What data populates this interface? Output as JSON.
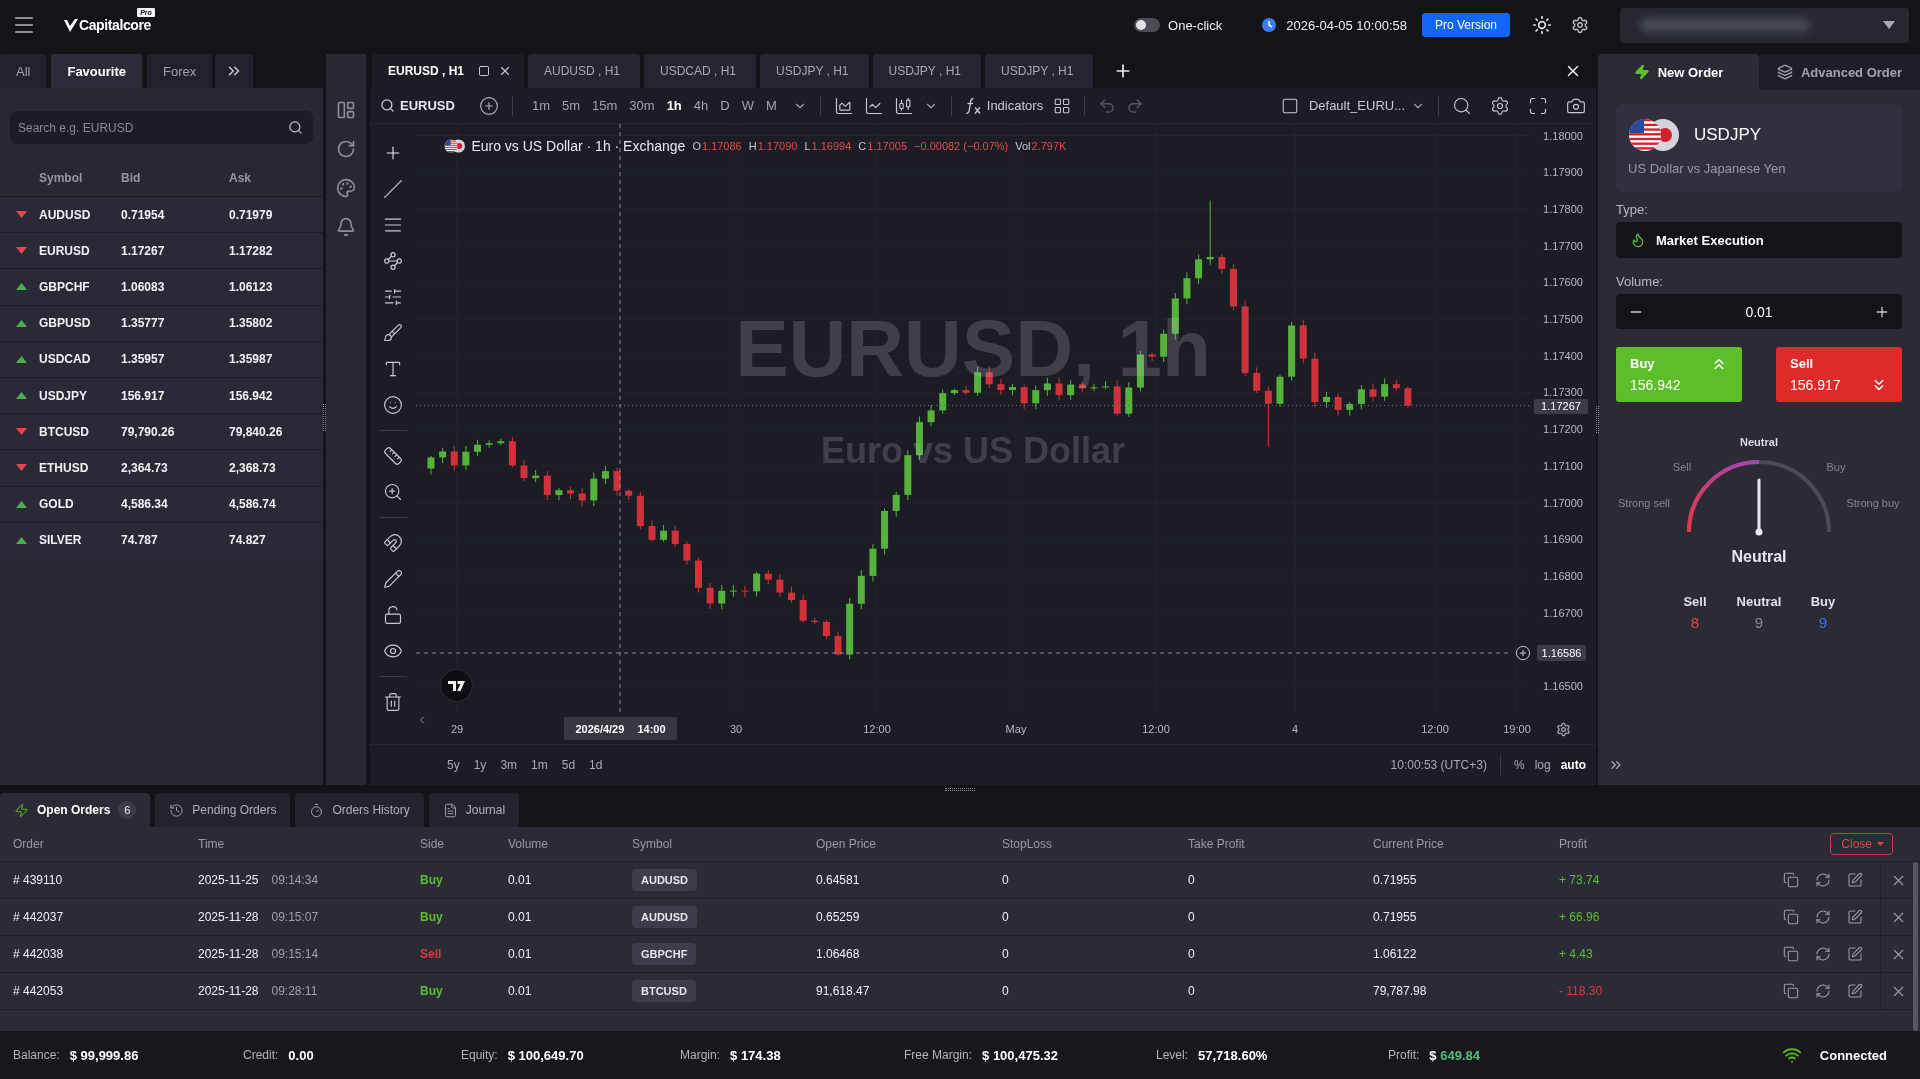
{
  "top_bar": {
    "logo": {
      "name": "Capitalcore",
      "badge": "Pro"
    },
    "one_click": {
      "label": "One-click",
      "on": false
    },
    "datetime": "2026-04-05 10:00:58",
    "pro_button": "Pro Version"
  },
  "watchlist": {
    "tabs": [
      {
        "label": "All",
        "selected": false
      },
      {
        "label": "Favourite",
        "selected": true
      },
      {
        "label": "Forex",
        "selected": false
      }
    ],
    "search": {
      "placeholder": "Search e.g. EURUSD"
    },
    "columns": [
      "Symbol",
      "Bid",
      "Ask"
    ],
    "rows": [
      {
        "symbol": "AUDUSD",
        "bid": "0.71954",
        "ask": "0.71979",
        "rising": false
      },
      {
        "symbol": "EURUSD",
        "bid": "1.17267",
        "ask": "1.17282",
        "rising": false
      },
      {
        "symbol": "GBPCHF",
        "bid": "1.06083",
        "ask": "1.06123",
        "rising": true
      },
      {
        "symbol": "GBPUSD",
        "bid": "1.35777",
        "ask": "1.35802",
        "rising": true
      },
      {
        "symbol": "USDCAD",
        "bid": "1.35957",
        "ask": "1.35987",
        "rising": true
      },
      {
        "symbol": "USDJPY",
        "bid": "156.917",
        "ask": "156.942",
        "rising": true
      },
      {
        "symbol": "BTCUSD",
        "bid": "79,790.26",
        "ask": "79,840.26",
        "rising": false
      },
      {
        "symbol": "ETHUSD",
        "bid": "2,364.73",
        "ask": "2,368.73",
        "rising": false
      },
      {
        "symbol": "GOLD",
        "bid": "4,586.34",
        "ask": "4,586.74",
        "rising": true
      },
      {
        "symbol": "SILVER",
        "bid": "74.787",
        "ask": "74.827",
        "rising": true
      }
    ]
  },
  "chart": {
    "tabs": [
      {
        "label": "EURUSD , H1",
        "selected": true
      },
      {
        "label": "AUDUSD , H1",
        "selected": false
      },
      {
        "label": "USDCAD , H1",
        "selected": false
      },
      {
        "label": "USDJPY , H1",
        "selected": false
      },
      {
        "label": "USDJPY , H1",
        "selected": false
      },
      {
        "label": "USDJPY , H1",
        "selected": false
      }
    ],
    "toolbar": {
      "symbol": "EURUSD",
      "intervals": [
        {
          "label": "1m",
          "selected": false
        },
        {
          "label": "5m",
          "selected": false
        },
        {
          "label": "15m",
          "selected": false
        },
        {
          "label": "30m",
          "selected": false
        },
        {
          "label": "1h",
          "selected": true
        },
        {
          "label": "4h",
          "selected": false
        },
        {
          "label": "D",
          "selected": false
        },
        {
          "label": "W",
          "selected": false
        },
        {
          "label": "M",
          "selected": false
        }
      ],
      "indicators": "Indicators",
      "layout": "Default_EURU..."
    },
    "legend": {
      "title": "Euro vs US Dollar · 1h · Exchange",
      "falling": true,
      "ohlc": [
        {
          "label": "O",
          "value": "1.17086"
        },
        {
          "label": "H",
          "value": "1.17090"
        },
        {
          "label": "L",
          "value": "1.16994"
        },
        {
          "label": "C",
          "value": "1.17005"
        }
      ],
      "change": "−0.00082 (−0.07%)",
      "volume_label": "Vol",
      "volume": "2.797K"
    },
    "watermark": {
      "symbol": "EURUSD, 1h",
      "description": "Euro vs US Dollar"
    },
    "price_axis": {
      "labels": [
        {
          "text": "1.18000",
          "kind": "tick"
        },
        {
          "text": "1.17900",
          "kind": "tick"
        },
        {
          "text": "1.17800",
          "kind": "tick"
        },
        {
          "text": "1.17700",
          "kind": "tick"
        },
        {
          "text": "1.17600",
          "kind": "tick"
        },
        {
          "text": "1.17500",
          "kind": "tick"
        },
        {
          "text": "1.17400",
          "kind": "tick"
        },
        {
          "text": "1.17300",
          "kind": "tick"
        },
        {
          "text": "1.17200",
          "kind": "tick"
        },
        {
          "text": "1.17100",
          "kind": "tick"
        },
        {
          "text": "1.17000",
          "kind": "tick"
        },
        {
          "text": "1.16900",
          "kind": "tick"
        },
        {
          "text": "1.16800",
          "kind": "tick"
        },
        {
          "text": "1.16700",
          "kind": "tick"
        },
        {
          "text": "1.16586",
          "kind": "crosshair"
        },
        {
          "text": "1.16500",
          "kind": "tick"
        }
      ],
      "last_price": "1.17267"
    },
    "time_axis": {
      "ticks": [
        "29",
        "30",
        "12:00",
        "May",
        "12:00",
        "4",
        "12:00",
        "19:00"
      ],
      "crosshair_time": "2026/4/29 14:00"
    },
    "ranges": [
      "5y",
      "1y",
      "3m",
      "1m",
      "5d",
      "1d"
    ],
    "clock": "10:00:53 (UTC+3)",
    "scale_options": [
      {
        "label": "%",
        "selected": false
      },
      {
        "label": "log",
        "selected": false
      },
      {
        "label": "auto",
        "selected": true
      }
    ]
  },
  "order_panel": {
    "tabs": [
      {
        "label": "New Order",
        "selected": true,
        "kind": "new"
      },
      {
        "label": "Advanced Order",
        "selected": false,
        "kind": "advanced"
      }
    ],
    "instrument": {
      "symbol": "USDJPY",
      "description": "US Dollar vs Japanese Yen"
    },
    "type": {
      "label": "Type:",
      "value": "Market Execution"
    },
    "volume": {
      "label": "Volume:",
      "value": "0.01"
    },
    "buy": {
      "label": "Buy",
      "price": "156.942"
    },
    "sell": {
      "label": "Sell",
      "price": "156.917"
    },
    "sentiment": {
      "scale": [
        "Strong sell",
        "Sell",
        "Neutral",
        "Buy",
        "Strong buy"
      ],
      "level": 0.5,
      "verdict": "Neutral",
      "counts": [
        {
          "label": "Sell",
          "value": "8",
          "kind": "sell"
        },
        {
          "label": "Neutral",
          "value": "9",
          "kind": "neutral"
        },
        {
          "label": "Buy",
          "value": "9",
          "kind": "buy"
        }
      ]
    }
  },
  "orders": {
    "tabs": [
      {
        "label": "Open Orders",
        "badge": "6",
        "selected": true,
        "kind": "open"
      },
      {
        "label": "Pending Orders",
        "selected": false,
        "kind": "pending"
      },
      {
        "label": "Orders History",
        "selected": false,
        "kind": "history"
      },
      {
        "label": "Journal",
        "selected": false,
        "kind": "journal"
      }
    ],
    "columns": [
      "Order",
      "Time",
      "Side",
      "Volume",
      "Symbol",
      "Open Price",
      "StopLoss",
      "Take Profit",
      "Current Price",
      "Profit"
    ],
    "close_button": "Close",
    "rows": [
      {
        "order": "# 439110",
        "date": "2025-11-25",
        "time": "09:14:34",
        "side": "Buy",
        "kind": "buy",
        "volume": "0.01",
        "symbol": "AUDUSD",
        "open_price": "0.64581",
        "stop_loss": "0",
        "take_profit": "0",
        "current_price": "0.71955",
        "profit": "+ 73.74",
        "gain": true
      },
      {
        "order": "# 442037",
        "date": "2025-11-28",
        "time": "09:15:07",
        "side": "Buy",
        "kind": "buy",
        "volume": "0.01",
        "symbol": "AUDUSD",
        "open_price": "0.65259",
        "stop_loss": "0",
        "take_profit": "0",
        "current_price": "0.71955",
        "profit": "+ 66.96",
        "gain": true
      },
      {
        "order": "# 442038",
        "date": "2025-11-28",
        "time": "09:15:14",
        "side": "Sell",
        "kind": "sell",
        "volume": "0.01",
        "symbol": "GBPCHF",
        "open_price": "1.06468",
        "stop_loss": "0",
        "take_profit": "0",
        "current_price": "1.06122",
        "profit": "+ 4.43",
        "gain": true
      },
      {
        "order": "# 442053",
        "date": "2025-11-28",
        "time": "09:28:11",
        "side": "Buy",
        "kind": "buy",
        "volume": "0.01",
        "symbol": "BTCUSD",
        "open_price": "91,618.47",
        "stop_loss": "0",
        "take_profit": "0",
        "current_price": "79,787.98",
        "profit": "- 118.30",
        "gain": false
      }
    ]
  },
  "status_bar": {
    "items": [
      {
        "label": "Balance:",
        "currency": "$",
        "value": "99,999.86",
        "gain": false
      },
      {
        "label": "Credit:",
        "value": "0.00",
        "gain": false
      },
      {
        "label": "Equity:",
        "currency": "$",
        "value": "100,649.70",
        "gain": false
      },
      {
        "label": "Margin:",
        "currency": "$",
        "value": "174.38",
        "gain": false
      },
      {
        "label": "Free Margin:",
        "currency": "$",
        "value": "100,475.32",
        "gain": false
      },
      {
        "label": "Level:",
        "value": "57,718.60%",
        "gain": false
      },
      {
        "label": "Profit:",
        "currency": "$",
        "value": "649.84",
        "gain": true
      }
    ],
    "connection": "Connected"
  }
}
